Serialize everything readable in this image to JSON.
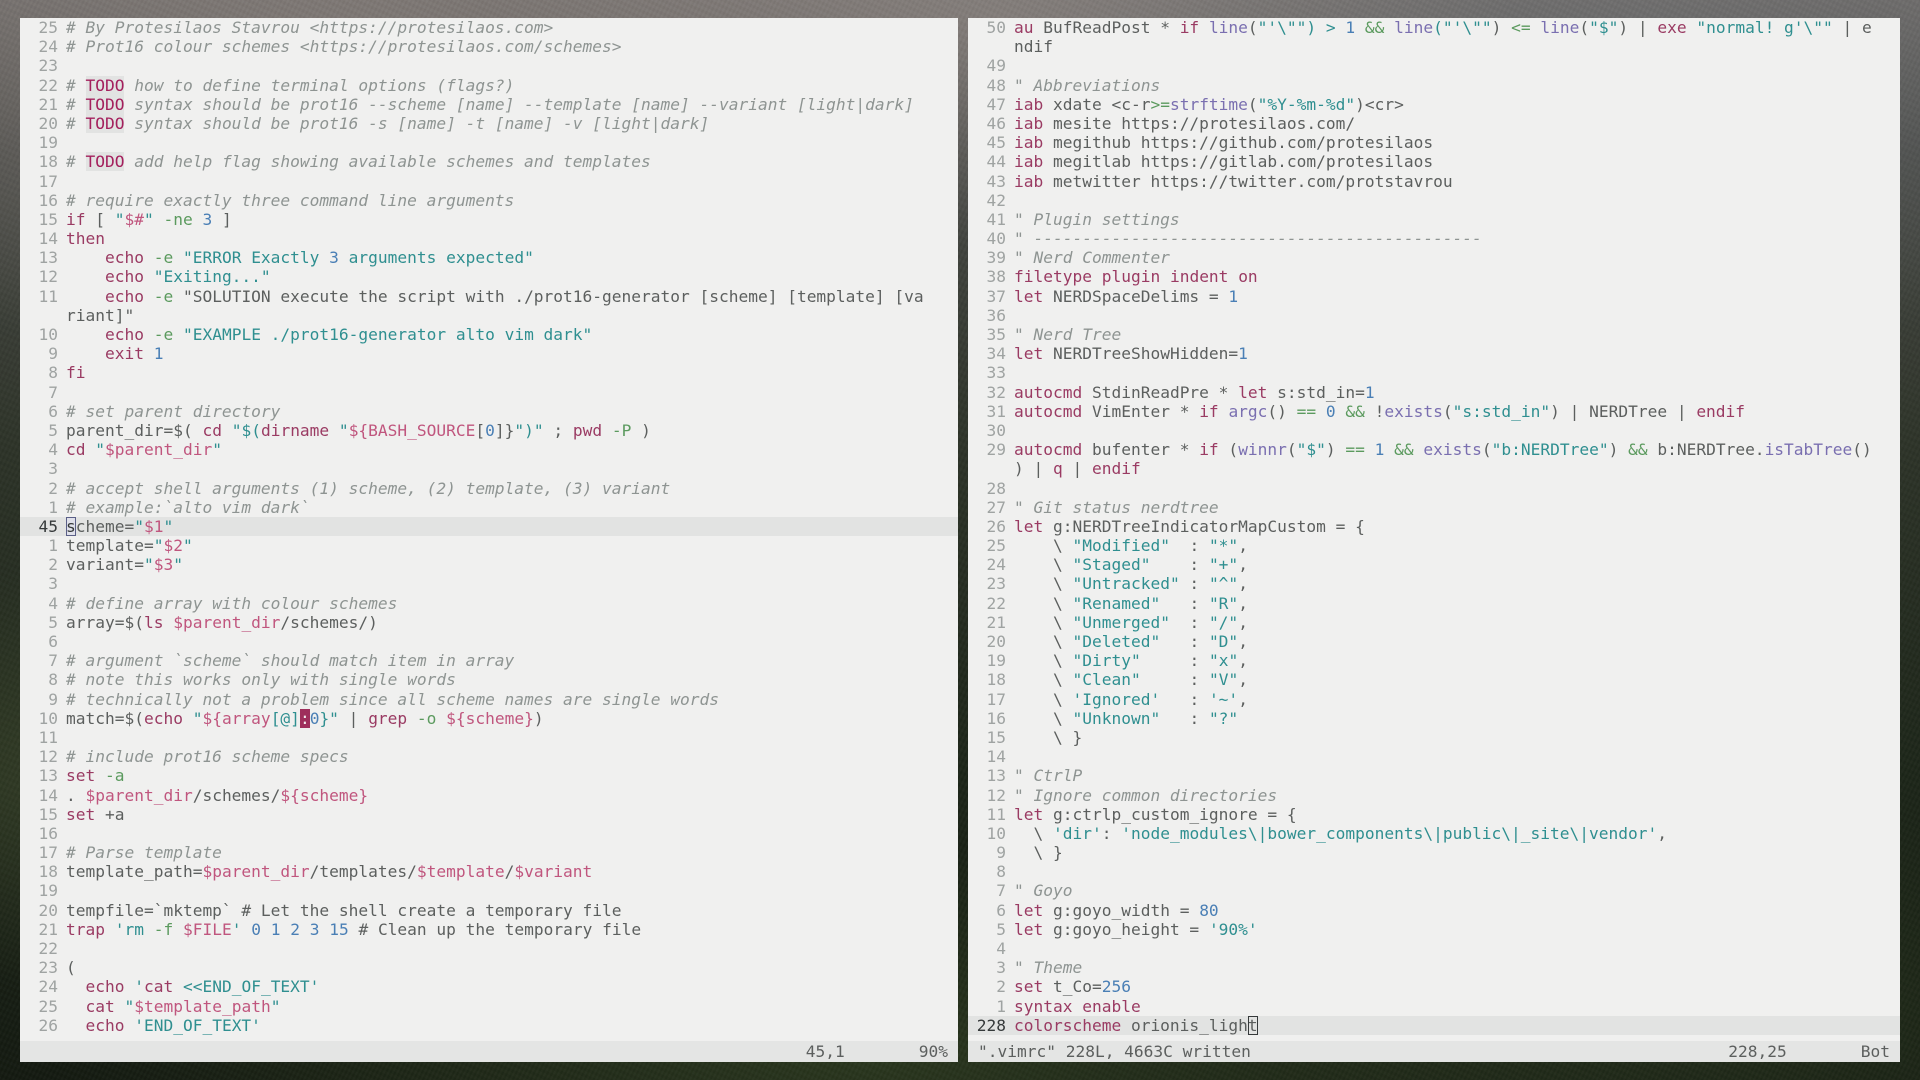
{
  "app": {
    "name": "vim",
    "colorscheme": "orionis_light",
    "background_hex": "#f0f0ef",
    "foreground_hex": "#5c5f5e",
    "cursorline_hex": "#e2e3e2",
    "statusline_hex": "#e4e5e4",
    "accent_hex": "#9e2f5c"
  },
  "left_pane": {
    "name": "prot16-generator-script",
    "lines": [
      {
        "n": "25",
        "text": "# By Protesilaos Stavrou <https://protesilaos.com>"
      },
      {
        "n": "24",
        "text": "# Prot16 colour schemes <https://protesilaos.com/schemes>"
      },
      {
        "n": "23",
        "text": ""
      },
      {
        "n": "22",
        "text": "# TODO how to define terminal options (flags?)"
      },
      {
        "n": "21",
        "text": "# TODO syntax should be prot16 --scheme [name] --template [name] --variant [light|dark]"
      },
      {
        "n": "20",
        "text": "# TODO syntax should be prot16 -s [name] -t [name] -v [light|dark]"
      },
      {
        "n": "19",
        "text": ""
      },
      {
        "n": "18",
        "text": "# TODO add help flag showing available schemes and templates"
      },
      {
        "n": "17",
        "text": ""
      },
      {
        "n": "16",
        "text": "# require exactly three command line arguments"
      },
      {
        "n": "15",
        "text": "if [ \"$#\" -ne 3 ]"
      },
      {
        "n": "14",
        "text": "then"
      },
      {
        "n": "13",
        "text": "    echo -e \"ERROR Exactly 3 arguments expected\""
      },
      {
        "n": "12",
        "text": "    echo \"Exiting...\""
      },
      {
        "n": "11",
        "text": "    echo -e \"SOLUTION execute the script with ./prot16-generator [scheme] [template] [variant]\""
      },
      {
        "n": "10",
        "text": "    echo -e \"EXAMPLE ./prot16-generator alto vim dark\""
      },
      {
        "n": "9",
        "text": "    exit 1"
      },
      {
        "n": "8",
        "text": "fi"
      },
      {
        "n": "7",
        "text": ""
      },
      {
        "n": "6",
        "text": "# set parent directory"
      },
      {
        "n": "5",
        "text": "parent_dir=$( cd \"$(dirname \"${BASH_SOURCE[0]}\")\" ; pwd -P )"
      },
      {
        "n": "4",
        "text": "cd \"$parent_dir\""
      },
      {
        "n": "3",
        "text": ""
      },
      {
        "n": "2",
        "text": "# accept shell arguments (1) scheme, (2) template, (3) variant"
      },
      {
        "n": "1",
        "text": "# example:`alto vim dark`"
      },
      {
        "n": "45",
        "text": "scheme=\"$1\"",
        "current": true
      },
      {
        "n": "1",
        "text": "template=\"$2\""
      },
      {
        "n": "2",
        "text": "variant=\"$3\""
      },
      {
        "n": "3",
        "text": ""
      },
      {
        "n": "4",
        "text": "# define array with colour schemes"
      },
      {
        "n": "5",
        "text": "array=$(ls $parent_dir/schemes/)"
      },
      {
        "n": "6",
        "text": ""
      },
      {
        "n": "7",
        "text": "# argument `scheme` should match item in array"
      },
      {
        "n": "8",
        "text": "# note this works only with single words"
      },
      {
        "n": "9",
        "text": "# technically not a problem since all scheme names are single words"
      },
      {
        "n": "10",
        "text": "match=$(echo \"${array[@]:0}\" | grep -o ${scheme})"
      },
      {
        "n": "11",
        "text": ""
      },
      {
        "n": "12",
        "text": "# include prot16 scheme specs"
      },
      {
        "n": "13",
        "text": "set -a"
      },
      {
        "n": "14",
        "text": ". $parent_dir/schemes/${scheme}"
      },
      {
        "n": "15",
        "text": "set +a"
      },
      {
        "n": "16",
        "text": ""
      },
      {
        "n": "17",
        "text": "# Parse template"
      },
      {
        "n": "18",
        "text": "template_path=$parent_dir/templates/$template/$variant"
      },
      {
        "n": "19",
        "text": ""
      },
      {
        "n": "20",
        "text": "tempfile=`mktemp` # Let the shell create a temporary file"
      },
      {
        "n": "21",
        "text": "trap 'rm -f $FILE' 0 1 2 3 15 # Clean up the temporary file"
      },
      {
        "n": "22",
        "text": ""
      },
      {
        "n": "23",
        "text": "("
      },
      {
        "n": "24",
        "text": "  echo 'cat <<END_OF_TEXT'"
      },
      {
        "n": "25",
        "text": "  cat \"$template_path\""
      },
      {
        "n": "26",
        "text": "  echo 'END_OF_TEXT'"
      }
    ],
    "statusline": {
      "file": "",
      "ruler": "45,1",
      "percent": "90%"
    }
  },
  "right_pane": {
    "name": "vimrc-buffer",
    "lines": [
      {
        "n": "50",
        "text": "au BufReadPost * if line(\"'\\\"\") > 1 && line(\"'\\\"\") <= line(\"$\") | exe \"normal! g'\\\"\" | endif"
      },
      {
        "n": "49",
        "text": ""
      },
      {
        "n": "48",
        "text": "\" Abbreviations"
      },
      {
        "n": "47",
        "text": "iab xdate <c-r>=strftime(\"%Y-%m-%d\")<cr>"
      },
      {
        "n": "46",
        "text": "iab mesite https://protesilaos.com/"
      },
      {
        "n": "45",
        "text": "iab megithub https://github.com/protesilaos"
      },
      {
        "n": "44",
        "text": "iab megitlab https://gitlab.com/protesilaos"
      },
      {
        "n": "43",
        "text": "iab metwitter https://twitter.com/protstavrou"
      },
      {
        "n": "42",
        "text": ""
      },
      {
        "n": "41",
        "text": "\" Plugin settings"
      },
      {
        "n": "40",
        "text": "\" ----------------------------------------------"
      },
      {
        "n": "39",
        "text": "\" Nerd Commenter"
      },
      {
        "n": "38",
        "text": "filetype plugin indent on"
      },
      {
        "n": "37",
        "text": "let NERDSpaceDelims = 1"
      },
      {
        "n": "36",
        "text": ""
      },
      {
        "n": "35",
        "text": "\" Nerd Tree"
      },
      {
        "n": "34",
        "text": "let NERDTreeShowHidden=1"
      },
      {
        "n": "33",
        "text": ""
      },
      {
        "n": "32",
        "text": "autocmd StdinReadPre * let s:std_in=1"
      },
      {
        "n": "31",
        "text": "autocmd VimEnter * if argc() == 0 && !exists(\"s:std_in\") | NERDTree | endif"
      },
      {
        "n": "30",
        "text": ""
      },
      {
        "n": "29",
        "text": "autocmd bufenter * if (winnr(\"$\") == 1 && exists(\"b:NERDTree\") && b:NERDTree.isTabTree()) | q | endif"
      },
      {
        "n": "28",
        "text": ""
      },
      {
        "n": "27",
        "text": "\" Git status nerdtree"
      },
      {
        "n": "26",
        "text": "let g:NERDTreeIndicatorMapCustom = {"
      },
      {
        "n": "25",
        "text": "    \\ \"Modified\"  : \"*\","
      },
      {
        "n": "24",
        "text": "    \\ \"Staged\"    : \"+\","
      },
      {
        "n": "23",
        "text": "    \\ \"Untracked\" : \"^\","
      },
      {
        "n": "22",
        "text": "    \\ \"Renamed\"   : \"R\","
      },
      {
        "n": "21",
        "text": "    \\ \"Unmerged\"  : \"/\","
      },
      {
        "n": "20",
        "text": "    \\ \"Deleted\"   : \"D\","
      },
      {
        "n": "19",
        "text": "    \\ \"Dirty\"     : \"x\","
      },
      {
        "n": "18",
        "text": "    \\ \"Clean\"     : \"V\","
      },
      {
        "n": "17",
        "text": "    \\ 'Ignored'   : '~',"
      },
      {
        "n": "16",
        "text": "    \\ \"Unknown\"   : \"?\""
      },
      {
        "n": "15",
        "text": "    \\ }"
      },
      {
        "n": "14",
        "text": ""
      },
      {
        "n": "13",
        "text": "\" CtrlP"
      },
      {
        "n": "12",
        "text": "\" Ignore common directories"
      },
      {
        "n": "11",
        "text": "let g:ctrlp_custom_ignore = {"
      },
      {
        "n": "10",
        "text": "  \\ 'dir': 'node_modules\\|bower_components\\|public\\|_site\\|vendor',"
      },
      {
        "n": "9",
        "text": "  \\ }"
      },
      {
        "n": "8",
        "text": ""
      },
      {
        "n": "7",
        "text": "\" Goyo"
      },
      {
        "n": "6",
        "text": "let g:goyo_width = 80"
      },
      {
        "n": "5",
        "text": "let g:goyo_height = '90%'"
      },
      {
        "n": "4",
        "text": ""
      },
      {
        "n": "3",
        "text": "\" Theme"
      },
      {
        "n": "2",
        "text": "set t_Co=256"
      },
      {
        "n": "1",
        "text": "syntax enable"
      },
      {
        "n": "228",
        "text": "colorscheme orionis_light",
        "current": true
      }
    ],
    "statusline": {
      "file": "\".vimrc\" 228L, 4663C written",
      "ruler": "228,25",
      "percent": "Bot"
    }
  }
}
